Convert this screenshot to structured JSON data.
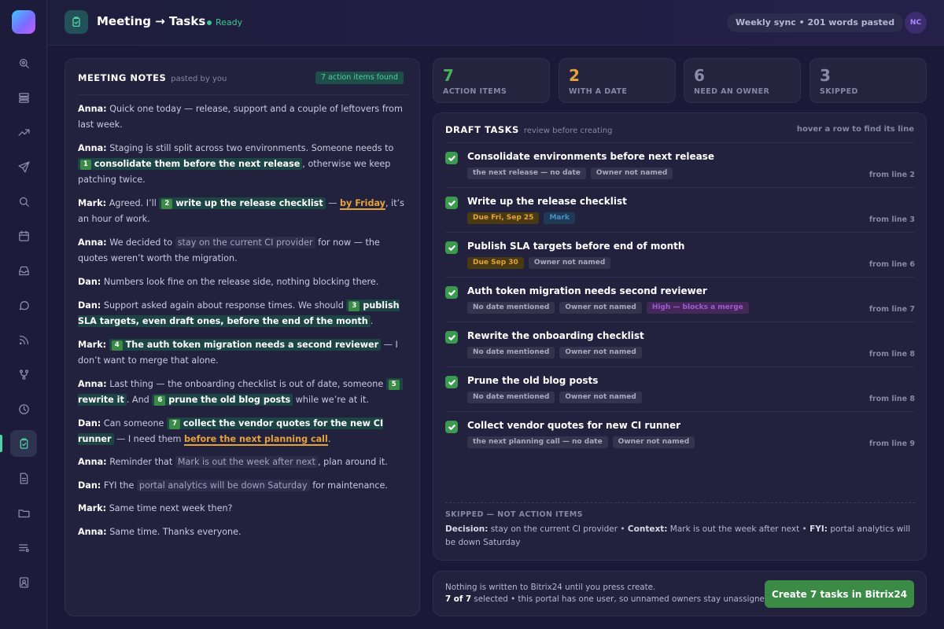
{
  "app": {
    "title": "Meeting → Tasks",
    "status": "Ready",
    "sync_label": "Weekly sync • 201 words pasted",
    "avatar_initials": "NC"
  },
  "sidebar": {
    "items": [
      {
        "icon": "search-icon"
      },
      {
        "icon": "layers-icon"
      },
      {
        "icon": "trending-icon"
      },
      {
        "icon": "send-icon"
      },
      {
        "icon": "search-icon"
      },
      {
        "icon": "calendar-icon"
      },
      {
        "icon": "inbox-icon"
      },
      {
        "icon": "chat-icon"
      },
      {
        "icon": "rss-icon"
      },
      {
        "icon": "branch-icon"
      },
      {
        "icon": "clock-icon"
      },
      {
        "icon": "clipboard-check-icon",
        "active": true
      },
      {
        "icon": "document-icon"
      },
      {
        "icon": "folder-icon"
      },
      {
        "icon": "list-icon"
      },
      {
        "icon": "contact-icon"
      }
    ]
  },
  "notes": {
    "title": "MEETING NOTES",
    "subtitle": "pasted by you",
    "badge": "7 action items found",
    "lines": [
      {
        "speaker": "Anna:",
        "text": "Quick one today — release, support and a couple of leftovers from last week."
      },
      {
        "speaker": "Anna:",
        "pre": "Staging is still split across two environments. Someone needs to",
        "num": "1",
        "hl": "consolidate them before the next release",
        "post": ", otherwise we keep patching twice."
      },
      {
        "speaker": "Mark:",
        "pre": "Agreed. I’ll",
        "num": "2",
        "hl": "write up the release checklist",
        "mid": " — ",
        "date": "by Friday",
        "post": ", it’s an hour of work."
      },
      {
        "speaker": "Anna:",
        "pre": "We decided to",
        "muted": "stay on the current CI provider",
        "post": " for now — the quotes weren’t worth the migration."
      },
      {
        "speaker": "Dan:",
        "text": "Numbers look fine on the release side, nothing blocking there."
      },
      {
        "speaker": "Dan:",
        "pre": "Support asked again about response times. We should",
        "num": "3",
        "hl": "publish SLA targets, even draft ones, before the end of the month",
        "post": "."
      },
      {
        "speaker": "Mark:",
        "num": "4",
        "hl": "The auth token migration needs a second reviewer",
        "post": " — I don’t want to merge that alone."
      },
      {
        "speaker": "Anna:",
        "pre": "Last thing — the onboarding checklist is out of date, someone",
        "num": "5",
        "hl": "rewrite it",
        "mid": ". And ",
        "num2": "6",
        "hl2": "prune the old blog posts",
        "post": " while we’re at it."
      },
      {
        "speaker": "Dan:",
        "pre": "Can someone",
        "num": "7",
        "hl": "collect the vendor quotes for the new CI runner",
        "mid": " — I need them ",
        "date": "before the next planning call",
        "post": "."
      },
      {
        "speaker": "Anna:",
        "pre": "Reminder that",
        "muted": "Mark is out the week after next",
        "post": ", plan around it."
      },
      {
        "speaker": "Dan:",
        "pre": "FYI the",
        "muted": "portal analytics will be down Saturday",
        "post": " for maintenance."
      },
      {
        "speaker": "Mark:",
        "text": "Same time next week then?"
      },
      {
        "speaker": "Anna:",
        "text": "Same time. Thanks everyone."
      }
    ]
  },
  "stats": [
    {
      "value": "7",
      "label": "ACTION ITEMS",
      "color": "#46b25a"
    },
    {
      "value": "2",
      "label": "WITH A DATE",
      "color": "#e4a23a"
    },
    {
      "value": "6",
      "label": "NEED AN OWNER",
      "color": "#8a8ba8"
    },
    {
      "value": "3",
      "label": "SKIPPED",
      "color": "#8a8ba8"
    }
  ],
  "drafts": {
    "title": "DRAFT TASKS",
    "subtitle": "review before creating",
    "hint": "hover a row to find its line",
    "tasks": [
      {
        "title": "Consolidate environments before next release",
        "tags": [
          {
            "text": "the next release — no date",
            "kind": "plain"
          },
          {
            "text": "Owner not named",
            "kind": "plain"
          }
        ],
        "from": "from line 2"
      },
      {
        "title": "Write up the release checklist",
        "tags": [
          {
            "text": "Due Fri, Sep 25",
            "kind": "due"
          },
          {
            "text": "Mark",
            "kind": "owner"
          }
        ],
        "from": "from line 3"
      },
      {
        "title": "Publish SLA targets before end of month",
        "tags": [
          {
            "text": "Due Sep 30",
            "kind": "due"
          },
          {
            "text": "Owner not named",
            "kind": "plain"
          }
        ],
        "from": "from line 6"
      },
      {
        "title": "Auth token migration needs second reviewer",
        "tags": [
          {
            "text": "No date mentioned",
            "kind": "plain"
          },
          {
            "text": "Owner not named",
            "kind": "plain"
          },
          {
            "text": "High — blocks a merge",
            "kind": "high"
          }
        ],
        "from": "from line 7"
      },
      {
        "title": "Rewrite the onboarding checklist",
        "tags": [
          {
            "text": "No date mentioned",
            "kind": "plain"
          },
          {
            "text": "Owner not named",
            "kind": "plain"
          }
        ],
        "from": "from line 8"
      },
      {
        "title": "Prune the old blog posts",
        "tags": [
          {
            "text": "No date mentioned",
            "kind": "plain"
          },
          {
            "text": "Owner not named",
            "kind": "plain"
          }
        ],
        "from": "from line 8"
      },
      {
        "title": "Collect vendor quotes for new CI runner",
        "tags": [
          {
            "text": "the next planning call — no date",
            "kind": "plain"
          },
          {
            "text": "Owner not named",
            "kind": "plain"
          }
        ],
        "from": "from line 9"
      }
    ],
    "skipped_title": "SKIPPED — NOT ACTION ITEMS",
    "skipped": [
      {
        "label": "Decision:",
        "text": "stay on the current CI provider"
      },
      {
        "label": "Context:",
        "text": "Mark is out the week after next"
      },
      {
        "label": "FYI:",
        "text": "portal analytics will be down Saturday"
      }
    ]
  },
  "footer": {
    "line1": "Nothing is written to Bitrix24 until you press create.",
    "selected": "7 of 7",
    "line2": "selected • this portal has one user, so unnamed owners stay unassigned.",
    "button": "Create 7 tasks in Bitrix24"
  }
}
